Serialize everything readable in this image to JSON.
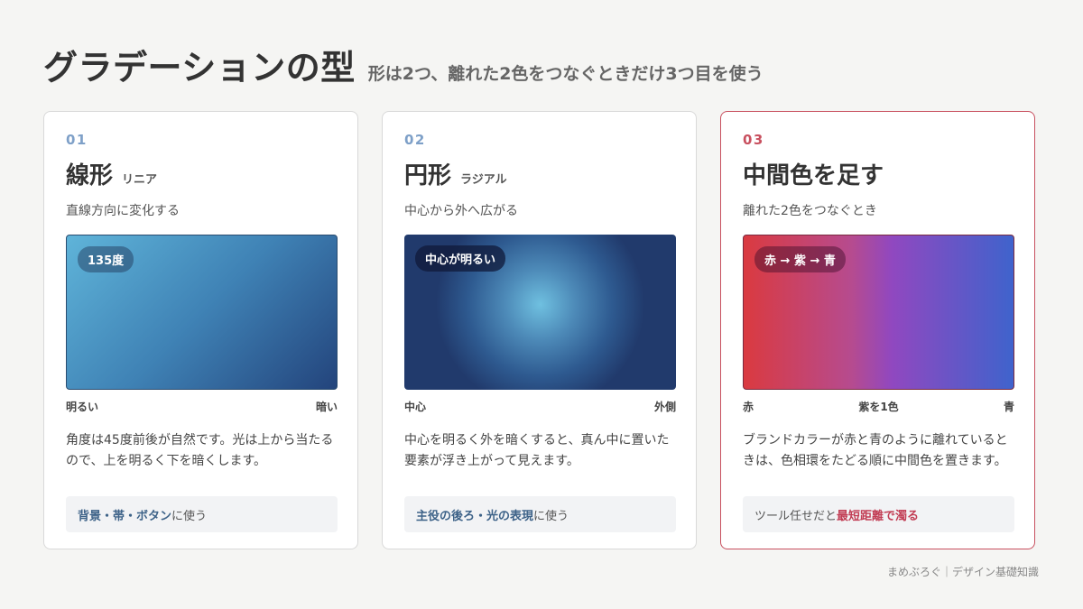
{
  "header": {
    "title": "グラデーションの型",
    "subtitle": "形は2つ、離れた2色をつなぐときだけ3つ目を使う"
  },
  "cards": [
    {
      "number": "01",
      "name": "線形",
      "kana": "リニア",
      "desc": "直線方向に変化する",
      "badge": "135度",
      "scale": [
        "明るい",
        "暗い"
      ],
      "body": "角度は45度前後が自然です。光は上から当たるので、上を明るく下を暗くします。",
      "usage_highlight": "背景・帯・ボタン",
      "usage_rest": "に使う",
      "colors": [
        "#5fb4d9",
        "#23447c"
      ]
    },
    {
      "number": "02",
      "name": "円形",
      "kana": "ラジアル",
      "desc": "中心から外へ広がる",
      "badge": "中心が明るい",
      "scale": [
        "中心",
        "外側"
      ],
      "body": "中心を明るく外を暗くすると、真ん中に置いた要素が浮き上がって見えます。",
      "usage_highlight": "主役の後ろ・光の表現",
      "usage_rest": "に使う",
      "colors": [
        "#6fc0e0",
        "#213a6c"
      ]
    },
    {
      "number": "03",
      "name": "中間色を足す",
      "desc": "離れた2色をつなぐとき",
      "badge": "赤 → 紫 → 青",
      "scale": [
        "赤",
        "紫を1色",
        "青"
      ],
      "body": "ブランドカラーが赤と青のように離れているときは、色相環をたどる順に中間色を置きます。",
      "usage_prefix": "ツール任せだと",
      "usage_highlight": "最短距離で濁る",
      "colors": [
        "#da3a40",
        "#9048c0",
        "#3f63cc"
      ],
      "accent": "#c8505f"
    }
  ],
  "footer": "まめぶろぐ｜デザイン基礎知識"
}
